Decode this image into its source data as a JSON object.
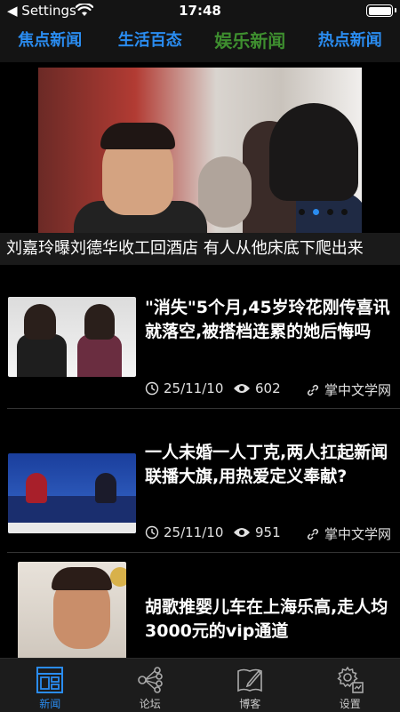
{
  "status_bar": {
    "back_label": "◀ Settings",
    "time": "17:48"
  },
  "top_tabs": [
    {
      "label": "焦点新闻",
      "active": false
    },
    {
      "label": "生活百态",
      "active": false
    },
    {
      "label": "娱乐新闻",
      "active": true
    },
    {
      "label": "热点新闻",
      "active": false
    }
  ],
  "banner": {
    "caption": "刘嘉玲曝刘德华收工回酒店 有人从他床底下爬出来",
    "dots": [
      false,
      true,
      false,
      false
    ]
  },
  "news": [
    {
      "title": "\"消失\"5个月,45岁玲花刚传喜讯就落空,被搭档连累的她后悔吗",
      "date": "25/11/10",
      "views": "602",
      "source": "掌中文学网"
    },
    {
      "title": "一人未婚一人丁克,两人扛起新闻联播大旗,用热爱定义奉献?",
      "date": "25/11/10",
      "views": "951",
      "source": "掌中文学网"
    },
    {
      "title": "胡歌推婴儿车在上海乐高,走人均3000元的vip通道"
    }
  ],
  "tabbar": [
    {
      "label": "新闻",
      "icon": "news-icon",
      "active": true
    },
    {
      "label": "论坛",
      "icon": "forum-icon",
      "active": false
    },
    {
      "label": "博客",
      "icon": "blog-icon",
      "active": false
    },
    {
      "label": "设置",
      "icon": "settings-icon",
      "active": false
    }
  ],
  "colors": {
    "accent": "#2a8cf0",
    "active_tab": "#3e8e2f"
  }
}
